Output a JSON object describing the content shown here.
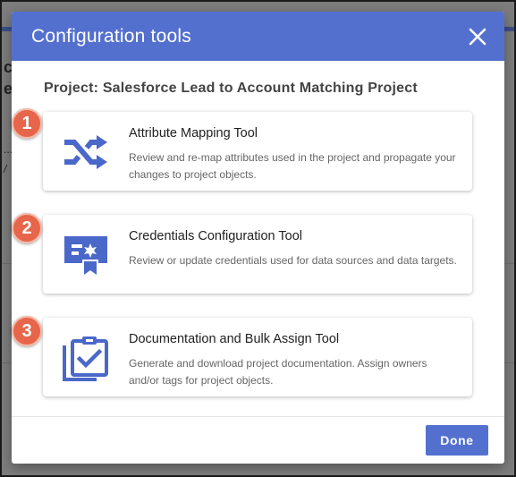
{
  "colors": {
    "header_bg": "#5470cf",
    "icon": "#4a68c9",
    "badge": "#e7654a",
    "done_button": "#5470cf"
  },
  "background": {
    "fragments": [
      "c",
      "e",
      "...",
      "/"
    ]
  },
  "dialog": {
    "title": "Configuration tools",
    "close_icon": "close-icon",
    "project_title": "Project: Salesforce Lead to Account Matching Project",
    "tools": [
      {
        "step": "1",
        "icon": "shuffle-icon",
        "name": "Attribute Mapping Tool",
        "description": "Review and re-map attributes used in the project and propagate your changes to project objects."
      },
      {
        "step": "2",
        "icon": "certificate-icon",
        "name": "Credentials Configuration Tool",
        "description": "Review or update credentials used for data sources and data targets."
      },
      {
        "step": "3",
        "icon": "clipboard-check-icon",
        "name": "Documentation and Bulk Assign Tool",
        "description": "Generate and download project documentation. Assign owners and/or tags for project objects."
      }
    ],
    "done_label": "Done"
  }
}
